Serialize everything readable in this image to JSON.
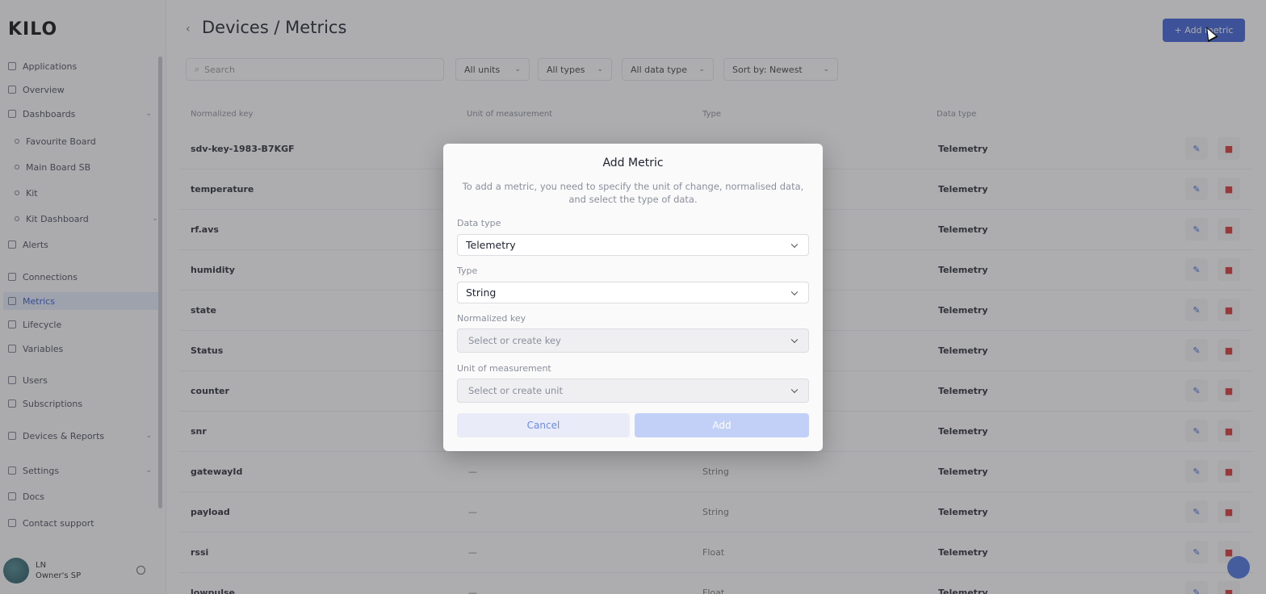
{
  "app": {
    "logo": "KILO"
  },
  "sidebar": {
    "items": [
      {
        "label": "Applications"
      },
      {
        "label": "Overview"
      },
      {
        "label": "Dashboards"
      },
      {
        "label": "Favourite Board"
      },
      {
        "label": "Main Board SB"
      },
      {
        "label": "Kit"
      },
      {
        "label": "Kit Dashboard"
      },
      {
        "label": "Alerts"
      },
      {
        "label": "Connections"
      },
      {
        "label": "Metrics"
      },
      {
        "label": "Lifecycle"
      },
      {
        "label": "Variables"
      },
      {
        "label": "Users"
      },
      {
        "label": "Subscriptions"
      },
      {
        "label": "Devices & Reports"
      },
      {
        "label": "Settings"
      },
      {
        "label": "Docs"
      },
      {
        "label": "Contact support"
      }
    ],
    "user": {
      "initials": "LN",
      "name": "Owner's SP"
    }
  },
  "header": {
    "breadcrumb": "Devices / Metrics",
    "add_button_label": "+ Add metric"
  },
  "toolbar": {
    "search_placeholder": "Search",
    "filters": [
      "All units",
      "All types",
      "All data type",
      "Sort by: Newest"
    ]
  },
  "table": {
    "columns": [
      "Normalized key",
      "Unit of measurement",
      "Type",
      "Data type"
    ],
    "rows": [
      {
        "key": "sdv-key-1983-B7KGF",
        "unit": "",
        "type": "",
        "data_type": "Telemetry"
      },
      {
        "key": "temperature",
        "unit": "",
        "type": "",
        "data_type": "Telemetry"
      },
      {
        "key": "rf.avs",
        "unit": "",
        "type": "",
        "data_type": "Telemetry"
      },
      {
        "key": "humidity",
        "unit": "",
        "type": "",
        "data_type": "Telemetry"
      },
      {
        "key": "state",
        "unit": "",
        "type": "",
        "data_type": "Telemetry"
      },
      {
        "key": "Status",
        "unit": "",
        "type": "",
        "data_type": "Telemetry"
      },
      {
        "key": "counter",
        "unit": "",
        "type": "",
        "data_type": "Telemetry"
      },
      {
        "key": "snr",
        "unit": "",
        "type": "",
        "data_type": "Telemetry"
      },
      {
        "key": "gatewayId",
        "unit": "—",
        "type": "String",
        "data_type": "Telemetry"
      },
      {
        "key": "payload",
        "unit": "—",
        "type": "String",
        "data_type": "Telemetry"
      },
      {
        "key": "rssi",
        "unit": "—",
        "type": "Float",
        "data_type": "Telemetry"
      },
      {
        "key": "lowpulse",
        "unit": "—",
        "type": "Float",
        "data_type": "Telemetry"
      }
    ]
  },
  "modal": {
    "title": "Add Metric",
    "description": "To add a metric, you need to specify the unit of change, normalised data, and select the type of data.",
    "data_type_label": "Data type",
    "data_type_value": "Telemetry",
    "type_label": "Type",
    "type_value": "String",
    "normalized_key_label": "Normalized key",
    "normalized_key_placeholder": "Select or create key",
    "unit_label": "Unit of measurement",
    "unit_placeholder": "Select or create unit",
    "cancel_label": "Cancel",
    "add_label": "Add"
  },
  "colors": {
    "accent": "#3e63d8",
    "danger": "#d93636",
    "overlay": "rgba(60,60,64,0.42)"
  }
}
